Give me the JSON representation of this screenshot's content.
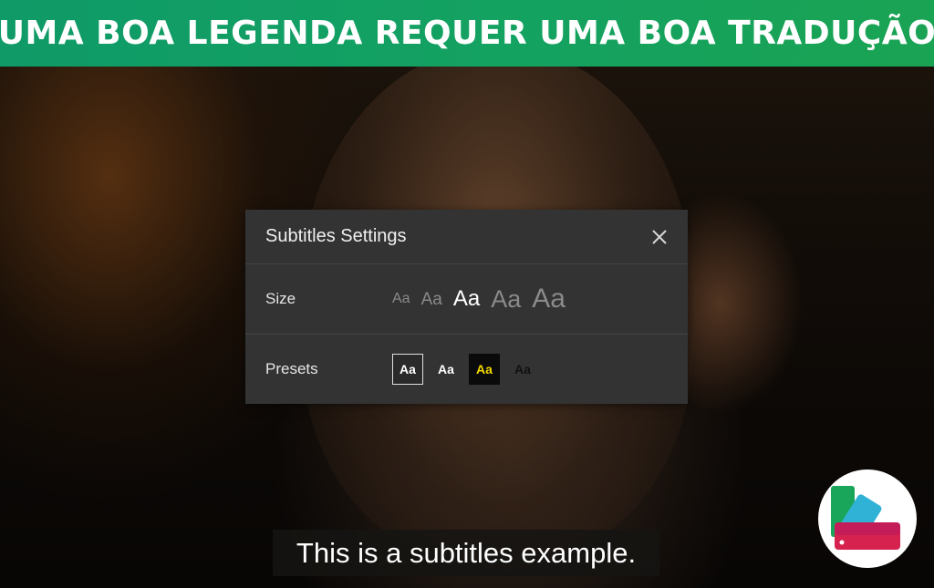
{
  "banner": {
    "text": "UMA BOA LEGENDA REQUER UMA BOA TRADUÇÃO",
    "bg_color": "#14a261"
  },
  "dialog": {
    "title": "Subtitles Settings",
    "close_icon": "close-icon",
    "size_label": "Size",
    "size_options": [
      "Aa",
      "Aa",
      "Aa",
      "Aa",
      "Aa"
    ],
    "size_selected_index": 2,
    "presets_label": "Presets",
    "preset_options": [
      "Aa",
      "Aa",
      "Aa",
      "Aa"
    ],
    "preset_selected_index": 0,
    "preset_colors": [
      "#ffffff",
      "#ffffff",
      "#f2d800",
      "#111111"
    ]
  },
  "subtitle": {
    "text": "This is a subtitles example."
  },
  "logo": {
    "icon": "app-logo-icon"
  }
}
